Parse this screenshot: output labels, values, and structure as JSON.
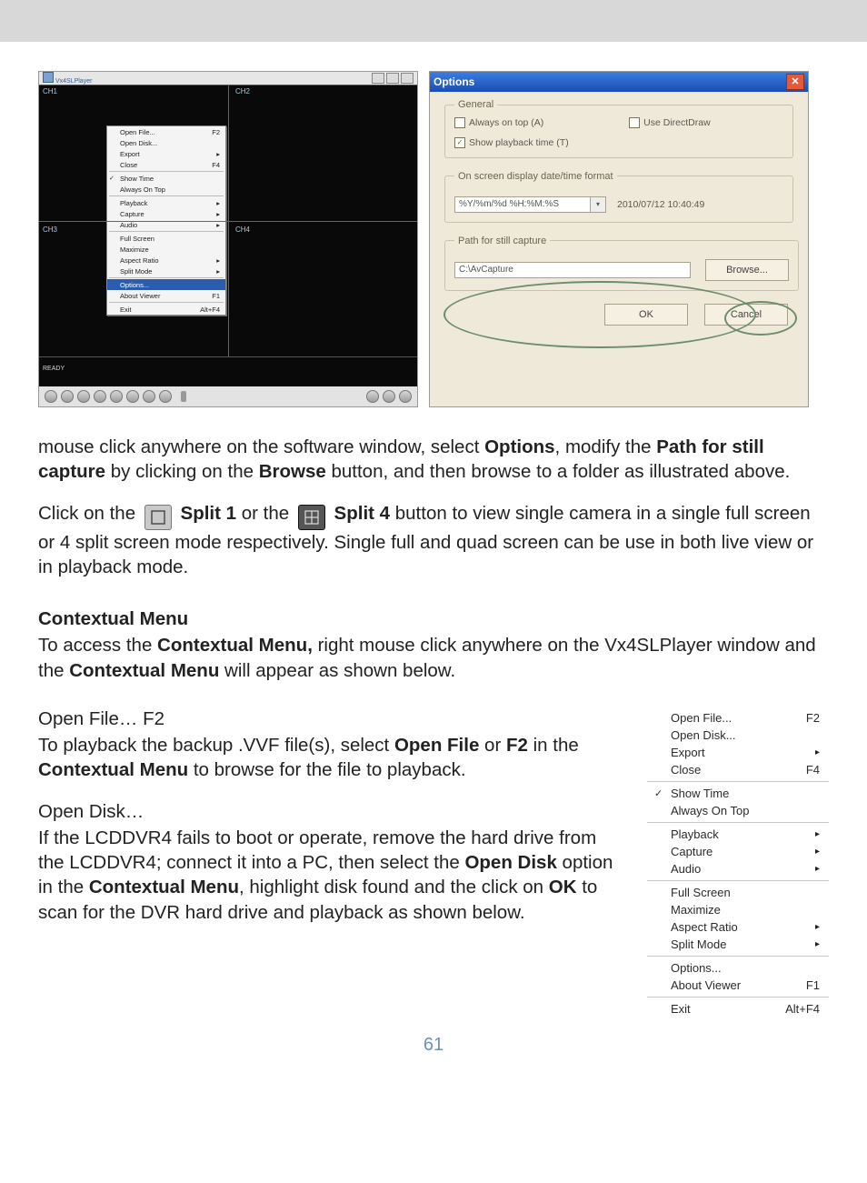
{
  "page_number": "61",
  "player_shot": {
    "title_left": "Vx4SLPlayer",
    "ch_labels": {
      "tl": "CH1",
      "tr": "CH2",
      "bl": "CH3",
      "br": "CH4"
    },
    "ready": "READY",
    "ctx": {
      "open_file": "Open File...",
      "open_file_sc": "F2",
      "open_disk": "Open Disk...",
      "export": "Export",
      "close": "Close",
      "close_sc": "F4",
      "show_time": "Show Time",
      "always_on_top": "Always On Top",
      "playback": "Playback",
      "capture": "Capture",
      "audio": "Audio",
      "full_screen": "Full Screen",
      "maximize": "Maximize",
      "aspect_ratio": "Aspect Ratio",
      "split_mode": "Split Mode",
      "options": "Options...",
      "about": "About Viewer",
      "about_sc": "F1",
      "exit": "Exit",
      "exit_sc": "Alt+F4"
    }
  },
  "options_dialog": {
    "title": "Options",
    "general_legend": "General",
    "always_on_top": "Always on top (A)",
    "use_directdraw": "Use DirectDraw",
    "show_playback_time": "Show playback time (T)",
    "osd_legend": "On screen display date/time format",
    "osd_format": "%Y/%m/%d %H:%M:%S",
    "osd_sample": "2010/07/12 10:40:49",
    "path_legend": "Path for still capture",
    "path_value": "C:\\AvCapture",
    "browse": "Browse...",
    "ok": "OK",
    "cancel": "Cancel"
  },
  "para1": {
    "t1": "mouse click anywhere on the software window, select ",
    "options": "Options",
    "t2": ", modify the ",
    "path": "Path for still capture",
    "t3": " by clicking on the ",
    "browse": "Browse",
    "t4": " button, and then browse to a folder as illustrated above."
  },
  "para2": {
    "t1": "Click on the ",
    "split1": "Split 1",
    "t2": " or the ",
    "split4": "Split 4",
    "t3": " button to view single camera in a single full screen or 4 split screen mode respectively.  Single full and quad screen can be use in both live view or in playback mode."
  },
  "ctx_heading": "Contextual Menu",
  "ctx_para": {
    "t1": "To access the ",
    "cm": "Contextual Menu,",
    "t2": " right mouse click anywhere on the Vx4SLPlayer window and the ",
    "cm2": "Contextual Menu",
    "t3": " will appear as shown below."
  },
  "openfile_heading": "Open File… F2",
  "openfile_para": {
    "t1": "To playback the backup .VVF file(s), select ",
    "of": "Open File",
    "t2": " or ",
    "f2": "F2",
    "t3": " in the ",
    "cm": "Contextual Menu",
    "t4": " to browse for the file to playback."
  },
  "opendisk_heading": "Open Disk…",
  "opendisk_para": {
    "t1": "If the LCDDVR4 fails to boot or operate, remove the hard drive from the LCDDVR4; connect it into a PC, then select the ",
    "od": "Open Disk",
    "t2": " option in the ",
    "cm": "Contextual Menu",
    "t3": ", highlight disk found and the click on ",
    "ok": "OK",
    "t4": " to scan for the DVR hard drive and playback as shown below."
  },
  "ctx_menu_shot": {
    "open_file": "Open File...",
    "open_file_sc": "F2",
    "open_disk": "Open Disk...",
    "export": "Export",
    "close": "Close",
    "close_sc": "F4",
    "show_time": "Show Time",
    "always_on_top": "Always On Top",
    "playback": "Playback",
    "capture": "Capture",
    "audio": "Audio",
    "full_screen": "Full Screen",
    "maximize": "Maximize",
    "aspect_ratio": "Aspect Ratio",
    "split_mode": "Split Mode",
    "options": "Options...",
    "about": "About Viewer",
    "about_sc": "F1",
    "exit": "Exit",
    "exit_sc": "Alt+F4"
  }
}
